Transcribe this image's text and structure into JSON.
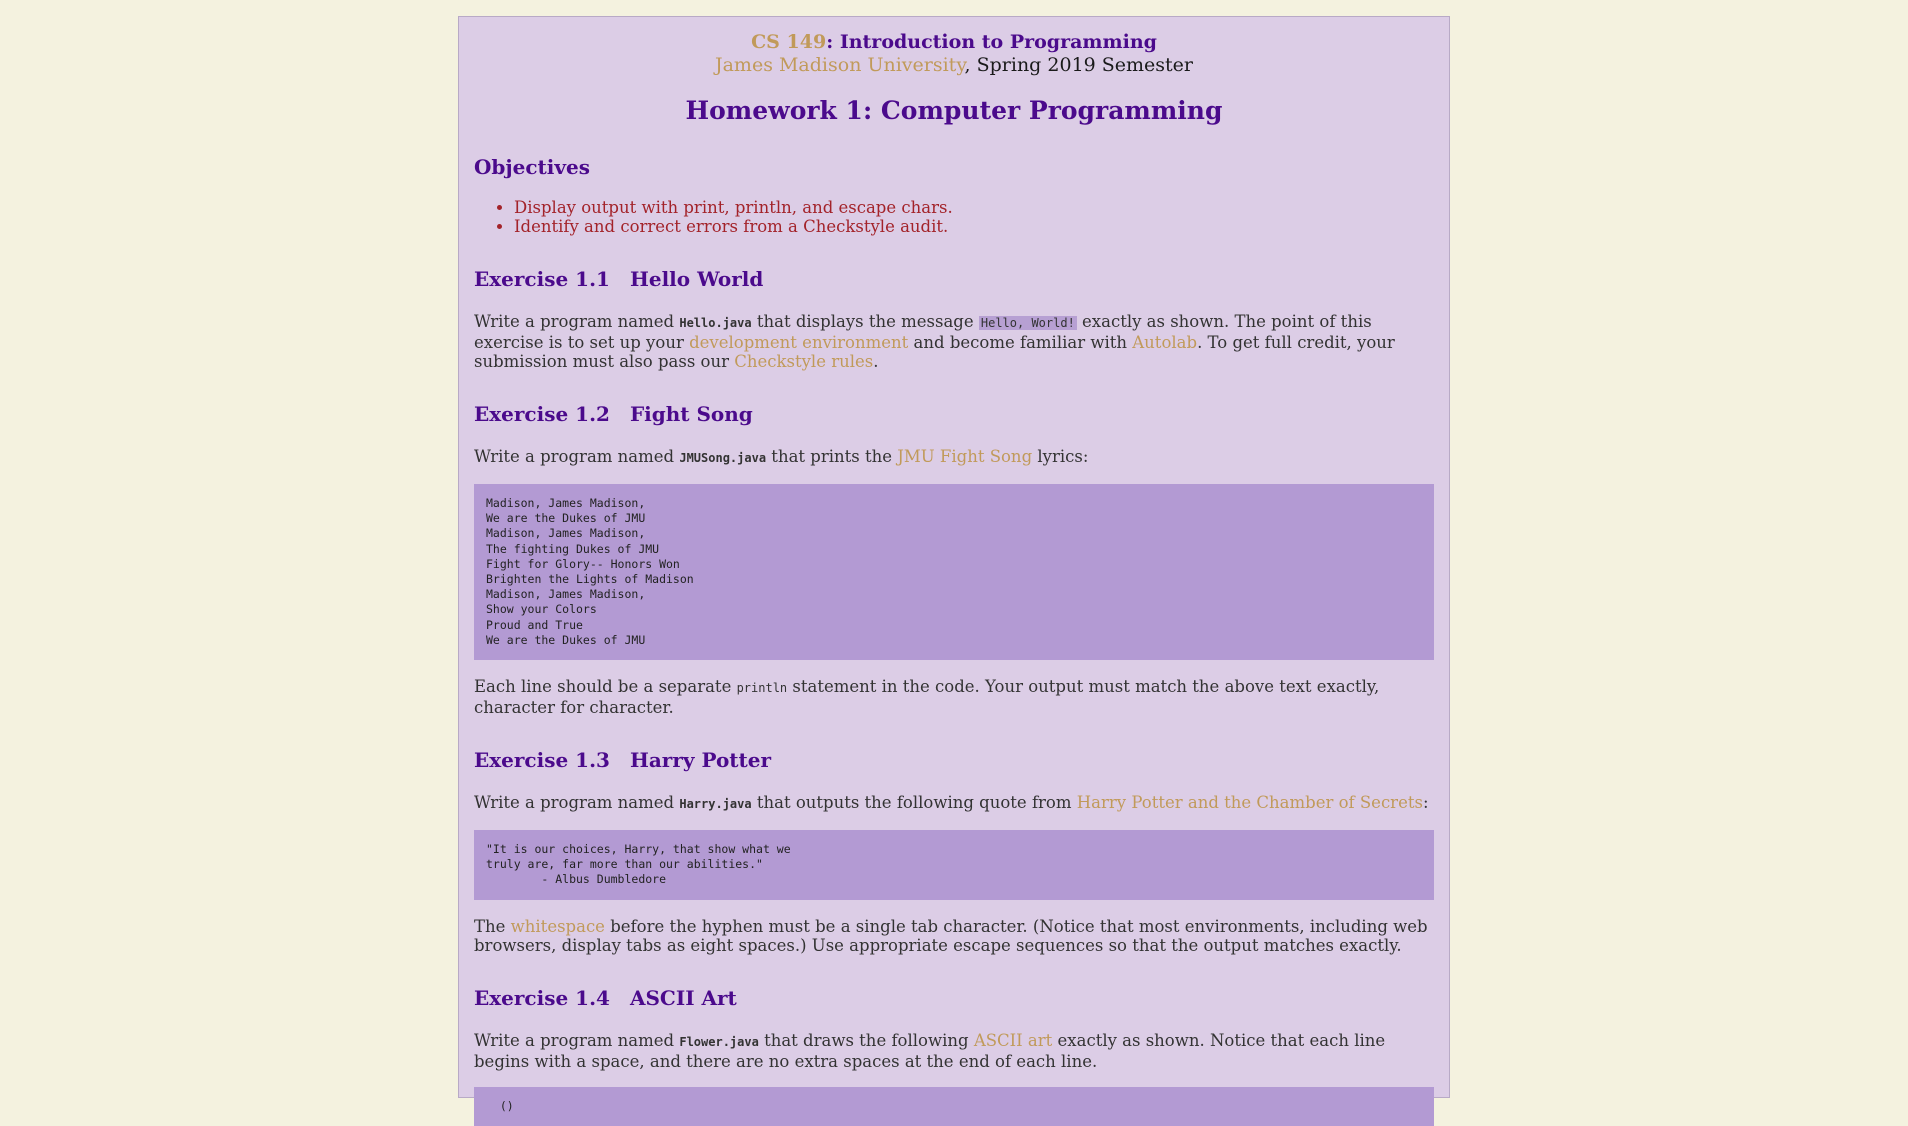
{
  "header": {
    "course_code": "CS 149",
    "course_sep": ": ",
    "course_name": "Introduction to Programming",
    "university": "James Madison University",
    "semester_text": ", Spring 2019 Semester"
  },
  "title": "Homework 1: Computer Programming",
  "objectives": {
    "heading": "Objectives",
    "items": [
      "Display output with print, println, and escape chars.",
      "Identify and correct errors from a Checkstyle audit."
    ]
  },
  "ex1": {
    "num": "Exercise 1.1",
    "name": "Hello World",
    "t1": "Write a program named ",
    "file": "Hello.java",
    "t2": " that displays the message ",
    "message": "Hello, World!",
    "t3": " exactly as shown. The point of this exercise is to set up your ",
    "link1": "development environment",
    "t4": " and become familiar with ",
    "link2": "Autolab",
    "t5": ". To get full credit, your submission must also pass our ",
    "link3": "Checkstyle rules",
    "t6": "."
  },
  "ex2": {
    "num": "Exercise 1.2",
    "name": "Fight Song",
    "t1": "Write a program named ",
    "file": "JMUSong.java",
    "t2": " that prints the ",
    "link1": "JMU Fight Song",
    "t3": " lyrics:",
    "lyrics": "Madison, James Madison,\nWe are the Dukes of JMU\nMadison, James Madison,\nThe fighting Dukes of JMU\nFight for Glory-- Honors Won\nBrighten the Lights of Madison\nMadison, James Madison,\nShow your Colors\nProud and True\nWe are the Dukes of JMU",
    "a1": "Each line should be a separate ",
    "code": "println",
    "a2": " statement in the code. Your output must match the above text exactly, character for character."
  },
  "ex3": {
    "num": "Exercise 1.3",
    "name": "Harry Potter",
    "t1": "Write a program named ",
    "file": "Harry.java",
    "t2": " that outputs the following quote from ",
    "link1": "Harry Potter and the Chamber of Secrets",
    "t3": ":",
    "quote": "\"It is our choices, Harry, that show what we\ntruly are, far more than our abilities.\"\n\t- Albus Dumbledore",
    "a1": "The ",
    "link2": "whitespace",
    "a2": " before the hyphen must be a single tab character. (Notice that most environments, including web browsers, display tabs as eight spaces.) Use appropriate escape sequences so that the output matches exactly."
  },
  "ex4": {
    "num": "Exercise 1.4",
    "name": "ASCII Art",
    "t1": "Write a program named ",
    "file": "Flower.java",
    "t2": " that draws the following ",
    "link1": "ASCII art",
    "t3": " exactly as shown. Notice that each line begins with a space, and there are no extra spaces at the end of each line.",
    "art": "  ()"
  }
}
